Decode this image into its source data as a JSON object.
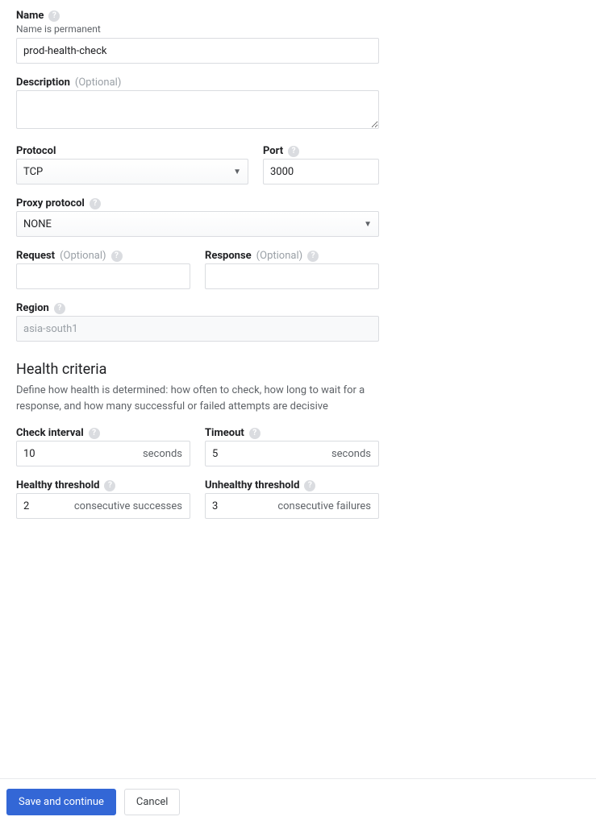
{
  "name": {
    "label": "Name",
    "sublabel": "Name is permanent",
    "value": "prod-health-check"
  },
  "description": {
    "label": "Description",
    "optional": "(Optional)",
    "value": ""
  },
  "protocol": {
    "label": "Protocol",
    "value": "TCP"
  },
  "port": {
    "label": "Port",
    "value": "3000"
  },
  "proxyProtocol": {
    "label": "Proxy protocol",
    "value": "NONE"
  },
  "request": {
    "label": "Request",
    "optional": "(Optional)",
    "value": ""
  },
  "response": {
    "label": "Response",
    "optional": "(Optional)",
    "value": ""
  },
  "region": {
    "label": "Region",
    "value": "asia-south1"
  },
  "healthCriteria": {
    "title": "Health criteria",
    "desc": "Define how health is determined: how often to check, how long to wait for a response, and how many successful or failed attempts are decisive"
  },
  "checkInterval": {
    "label": "Check interval",
    "value": "10",
    "unit": "seconds"
  },
  "timeout": {
    "label": "Timeout",
    "value": "5",
    "unit": "seconds"
  },
  "healthyThreshold": {
    "label": "Healthy threshold",
    "value": "2",
    "unit": "consecutive successes"
  },
  "unhealthyThreshold": {
    "label": "Unhealthy threshold",
    "value": "3",
    "unit": "consecutive failures"
  },
  "footer": {
    "save": "Save and continue",
    "cancel": "Cancel"
  }
}
